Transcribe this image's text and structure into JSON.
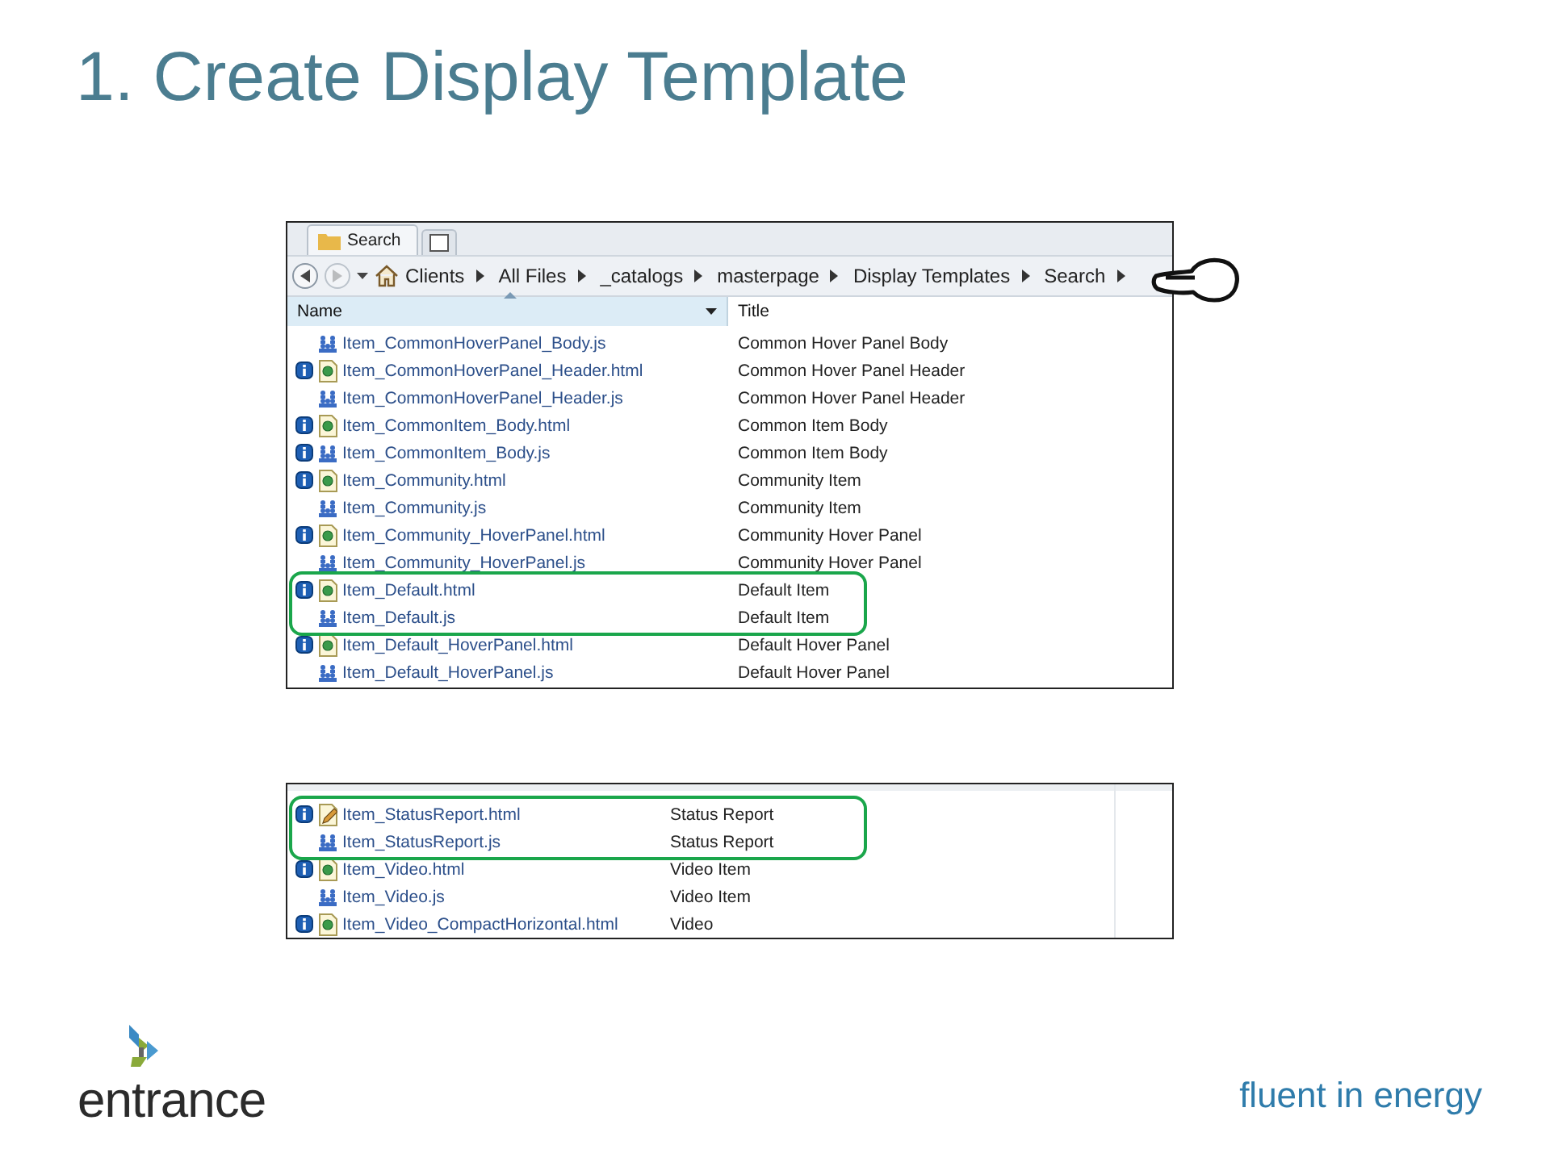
{
  "title": "1. Create Display Template",
  "explorer": {
    "tab": {
      "label": "Search"
    },
    "breadcrumbs": [
      "Clients",
      "All Files",
      "_catalogs",
      "masterpage",
      "Display Templates",
      "Search"
    ],
    "columns": [
      "Name",
      "Title"
    ],
    "rows": [
      {
        "name": "Item_CommonHoverPanel_Body.js",
        "title": "Common Hover Panel Body",
        "kind": "js",
        "info": false,
        "highlighted": false
      },
      {
        "name": "Item_CommonHoverPanel_Header.html",
        "title": "Common Hover Panel Header",
        "kind": "html",
        "info": true,
        "highlighted": false
      },
      {
        "name": "Item_CommonHoverPanel_Header.js",
        "title": "Common Hover Panel Header",
        "kind": "js",
        "info": false,
        "highlighted": false
      },
      {
        "name": "Item_CommonItem_Body.html",
        "title": "Common Item Body",
        "kind": "html",
        "info": true,
        "highlighted": false
      },
      {
        "name": "Item_CommonItem_Body.js",
        "title": "Common Item Body",
        "kind": "js",
        "info": true,
        "highlighted": false
      },
      {
        "name": "Item_Community.html",
        "title": "Community Item",
        "kind": "html",
        "info": true,
        "highlighted": false
      },
      {
        "name": "Item_Community.js",
        "title": "Community Item",
        "kind": "js",
        "info": false,
        "highlighted": false
      },
      {
        "name": "Item_Community_HoverPanel.html",
        "title": "Community Hover Panel",
        "kind": "html",
        "info": true,
        "highlighted": false
      },
      {
        "name": "Item_Community_HoverPanel.js",
        "title": "Community Hover Panel",
        "kind": "js",
        "info": false,
        "highlighted": false
      },
      {
        "name": "Item_Default.html",
        "title": "Default Item",
        "kind": "html",
        "info": true,
        "highlighted": true
      },
      {
        "name": "Item_Default.js",
        "title": "Default Item",
        "kind": "js",
        "info": false,
        "highlighted": true
      },
      {
        "name": "Item_Default_HoverPanel.html",
        "title": "Default Hover Panel",
        "kind": "html",
        "info": true,
        "highlighted": false
      },
      {
        "name": "Item_Default_HoverPanel.js",
        "title": "Default Hover Panel",
        "kind": "js",
        "info": false,
        "highlighted": false
      }
    ]
  },
  "explorer_2": {
    "rows": [
      {
        "name": "Item_StatusReport.html",
        "title": "Status Report",
        "kind": "html-edit",
        "info": true,
        "highlighted": true
      },
      {
        "name": "Item_StatusReport.js",
        "title": "Status Report",
        "kind": "js",
        "info": false,
        "highlighted": true
      },
      {
        "name": "Item_Video.html",
        "title": "Video Item",
        "kind": "html",
        "info": true,
        "highlighted": false
      },
      {
        "name": "Item_Video.js",
        "title": "Video Item",
        "kind": "js",
        "info": false,
        "highlighted": false
      },
      {
        "name": "Item_Video_CompactHorizontal.html",
        "title": "Video",
        "kind": "html",
        "info": true,
        "highlighted": false
      }
    ]
  },
  "footer": {
    "logo": "entrance",
    "tagline": "fluent in energy"
  }
}
